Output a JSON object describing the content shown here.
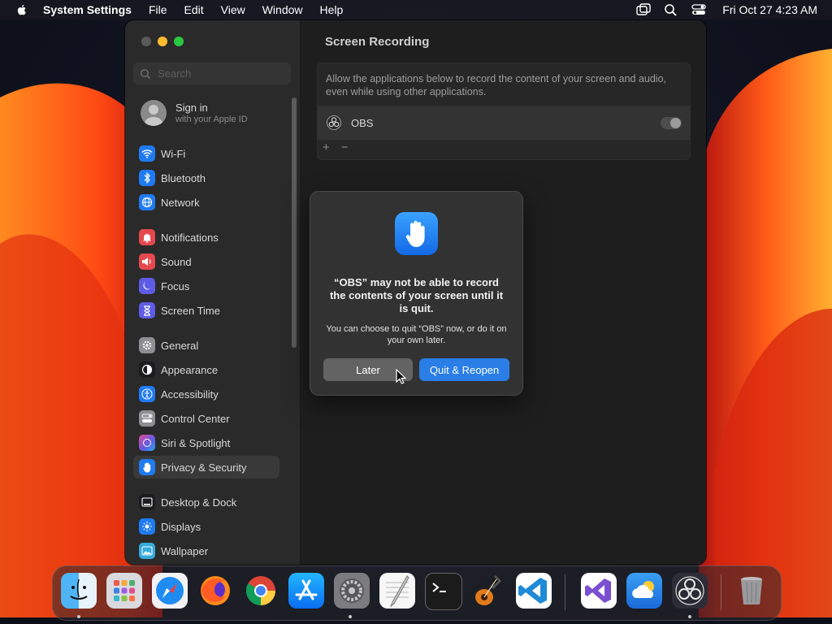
{
  "menubar": {
    "app_name": "System Settings",
    "menus": [
      "File",
      "Edit",
      "View",
      "Window",
      "Help"
    ],
    "clock": "Fri Oct 27  4:23 AM",
    "status_icons": [
      "screen-mirroring-icon",
      "spotlight-search-icon",
      "control-center-icon"
    ]
  },
  "sidebar": {
    "search_placeholder": "Search",
    "account": {
      "title": "Sign in",
      "subtitle": "with your Apple ID"
    },
    "items": [
      {
        "label": "Wi-Fi",
        "icon": "wifi-icon",
        "color": "#1f7bf2"
      },
      {
        "label": "Bluetooth",
        "icon": "bluetooth-icon",
        "color": "#1f7bf2"
      },
      {
        "label": "Network",
        "icon": "globe-icon",
        "color": "#1f7bf2"
      },
      {
        "label": "Notifications",
        "icon": "bell-icon",
        "color": "#e5484d"
      },
      {
        "label": "Sound",
        "icon": "speaker-icon",
        "color": "#e5484d"
      },
      {
        "label": "Focus",
        "icon": "moon-icon",
        "color": "#5e5ce6"
      },
      {
        "label": "Screen Time",
        "icon": "hourglass-icon",
        "color": "#5e5ce6"
      },
      {
        "label": "General",
        "icon": "gear-icon",
        "color": "#8e8e93"
      },
      {
        "label": "Appearance",
        "icon": "appearance-icon",
        "color": "#1c1c1e"
      },
      {
        "label": "Accessibility",
        "icon": "accessibility-icon",
        "color": "#1f7bf2"
      },
      {
        "label": "Control Center",
        "icon": "control-center-icon",
        "color": "#8e8e93"
      },
      {
        "label": "Siri & Spotlight",
        "icon": "siri-icon",
        "color": "#b04bd8"
      },
      {
        "label": "Privacy & Security",
        "icon": "hand-icon",
        "color": "#1f7bf2"
      },
      {
        "label": "Desktop & Dock",
        "icon": "dock-icon",
        "color": "#1c1c1e"
      },
      {
        "label": "Displays",
        "icon": "sun-icon",
        "color": "#1f7bf2"
      },
      {
        "label": "Wallpaper",
        "icon": "wallpaper-icon",
        "color": "#35aadc"
      }
    ],
    "selected": "Privacy & Security"
  },
  "content": {
    "title": "Screen Recording",
    "description": "Allow the applications below to record the content of your screen and audio, even while using other applications.",
    "apps": [
      {
        "name": "OBS",
        "enabled": false
      }
    ],
    "add_label": "+",
    "remove_label": "−"
  },
  "dialog": {
    "heading": "“OBS” may not be able to record the contents of your screen until it is quit.",
    "body": "You can choose to quit “OBS” now, or do it on your own later.",
    "later_label": "Later",
    "quit_label": "Quit & Reopen",
    "icon": "raised-hand-icon"
  },
  "dock": {
    "apps": [
      {
        "name": "Finder",
        "icon": "finder-icon",
        "running": true
      },
      {
        "name": "Launchpad",
        "icon": "launchpad-icon",
        "running": false
      },
      {
        "name": "Safari",
        "icon": "safari-icon",
        "running": false
      },
      {
        "name": "Firefox",
        "icon": "firefox-icon",
        "running": false
      },
      {
        "name": "Chrome",
        "icon": "chrome-icon",
        "running": false
      },
      {
        "name": "App Store",
        "icon": "app-store-icon",
        "running": false
      },
      {
        "name": "System Settings",
        "icon": "system-settings-icon",
        "running": true
      },
      {
        "name": "TextEdit",
        "icon": "textedit-icon",
        "running": false
      },
      {
        "name": "Terminal",
        "icon": "terminal-icon",
        "running": false
      },
      {
        "name": "GarageBand",
        "icon": "garageband-icon",
        "running": false
      },
      {
        "name": "VS Code",
        "icon": "vscode-icon",
        "running": false
      },
      {
        "name": "Visual Studio",
        "icon": "visual-studio-icon",
        "running": false
      },
      {
        "name": "Weather",
        "icon": "weather-icon",
        "running": false
      },
      {
        "name": "OBS",
        "icon": "obs-icon",
        "running": true
      },
      {
        "name": "Trash",
        "icon": "trash-icon",
        "running": false
      }
    ]
  }
}
